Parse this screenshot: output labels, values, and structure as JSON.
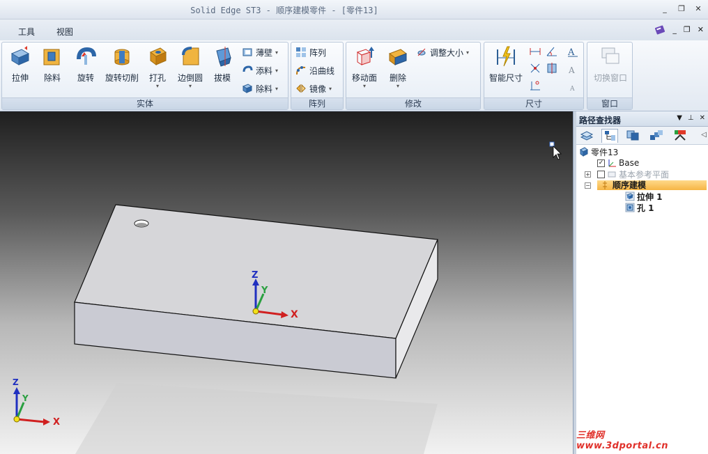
{
  "window": {
    "title": "Solid Edge ST3 - 顺序建模零件 - [零件13]",
    "controls": [
      "_",
      "❐",
      "✕"
    ]
  },
  "menubar": {
    "items": [
      "工具",
      "视图"
    ],
    "doc_controls": [
      "_",
      "❐",
      "✕"
    ]
  },
  "ribbon": {
    "groups": {
      "solid": {
        "label": "实体",
        "big_buttons": [
          "拉伸",
          "除料",
          "旋转",
          "旋转切削",
          "打孔",
          "边倒圆",
          "拔模"
        ],
        "small_buttons": [
          "薄壁",
          "添料",
          "除料"
        ]
      },
      "pattern": {
        "label": "阵列",
        "small_buttons": [
          "阵列",
          "沿曲线",
          "镜像"
        ]
      },
      "modify": {
        "label": "修改",
        "big_buttons": [
          "移动面",
          "删除"
        ],
        "small_buttons": [
          "调整大小"
        ]
      },
      "dimension": {
        "label": "尺寸",
        "big_buttons": [
          "智能尺寸"
        ]
      },
      "window": {
        "label": "窗口",
        "big_buttons": [
          "切换窗口"
        ]
      }
    }
  },
  "viewport": {
    "axes": {
      "x": "X",
      "y": "Y",
      "z": "Z"
    }
  },
  "pathfinder": {
    "title": "路径查找器",
    "header_controls": [
      "▼",
      "⊥",
      "✕"
    ],
    "tree": {
      "root": "零件13",
      "base": "Base",
      "ref_planes": "基本参考平面",
      "ordered": "顺序建模",
      "features": [
        "拉伸 1",
        "孔 1"
      ]
    }
  },
  "watermark": "三维网www.3dportal.cn",
  "colors": {
    "accent": "#f6b545",
    "axis_x": "#d02020",
    "axis_y": "#2aa040",
    "axis_z": "#2030c0"
  }
}
